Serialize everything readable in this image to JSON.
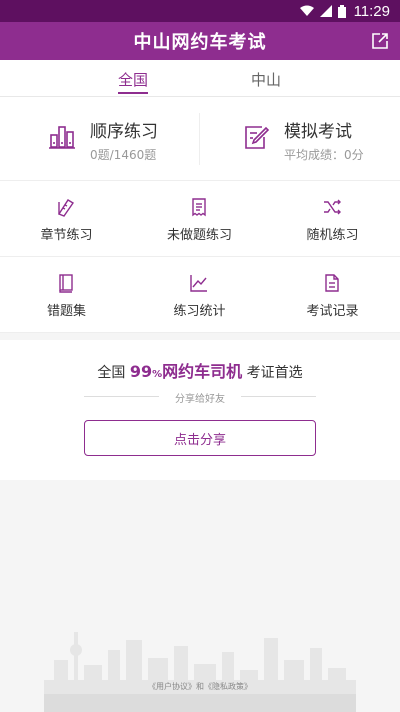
{
  "status_bar": {
    "time": "11:29"
  },
  "app_bar": {
    "title": "中山网约车考试",
    "share_icon": "share-icon"
  },
  "tabs": [
    {
      "label": "全国",
      "active": true
    },
    {
      "label": "中山",
      "active": false
    }
  ],
  "main": {
    "sequential": {
      "title": "顺序练习",
      "subtitle": "0题/1460题",
      "icon": "bar-chart-icon"
    },
    "mock": {
      "title": "模拟考试",
      "subtitle": "平均成绩：0分",
      "icon": "edit-icon"
    }
  },
  "grid": [
    {
      "label": "章节练习",
      "icon": "ruler-icon"
    },
    {
      "label": "未做题练习",
      "icon": "receipt-icon"
    },
    {
      "label": "随机练习",
      "icon": "shuffle-icon"
    },
    {
      "label": "错题集",
      "icon": "book-icon"
    },
    {
      "label": "练习统计",
      "icon": "line-chart-icon"
    },
    {
      "label": "考试记录",
      "icon": "document-icon"
    }
  ],
  "promo": {
    "prefix": "全国",
    "percent": "99",
    "percent_sign": "%",
    "highlight": "网约车司机",
    "suffix": "考证首选",
    "share_hint": "分享给好友",
    "share_button": "点击分享"
  },
  "footer": {
    "text": "《用户协议》和《隐私政策》"
  },
  "colors": {
    "accent": "#8e2d8f",
    "status_bar": "#5e1060"
  }
}
